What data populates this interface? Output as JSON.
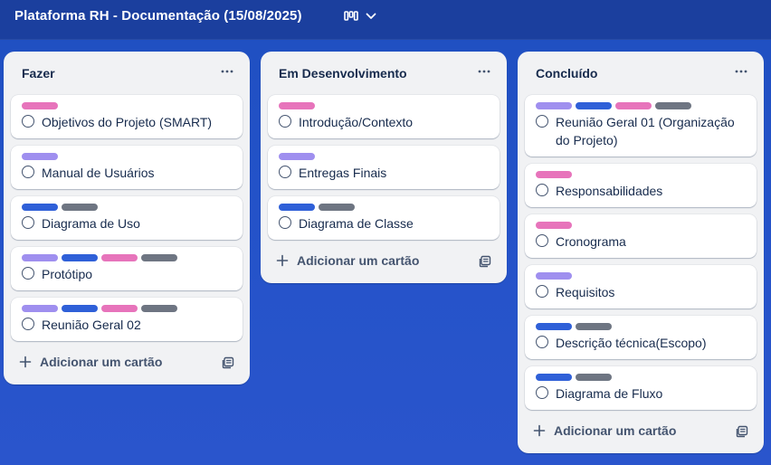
{
  "board": {
    "title": "Plataforma RH - Documentação (15/08/2025)"
  },
  "colors": {
    "purple": "#9f8fef",
    "blue": "#2f60d8",
    "pink": "#e774bb",
    "gray": "#6e7582"
  },
  "lists": [
    {
      "title": "Fazer",
      "add_label": "Adicionar um cartão",
      "cards": [
        {
          "title": "Objetivos do Projeto (SMART)",
          "labels": [
            "pink"
          ]
        },
        {
          "title": "Manual de Usuários",
          "labels": [
            "purple"
          ]
        },
        {
          "title": "Diagrama de Uso",
          "labels": [
            "blue",
            "gray"
          ]
        },
        {
          "title": "Protótipo",
          "labels": [
            "purple",
            "blue",
            "pink",
            "gray"
          ]
        },
        {
          "title": "Reunião Geral 02",
          "labels": [
            "purple",
            "blue",
            "pink",
            "gray"
          ]
        }
      ]
    },
    {
      "title": "Em Desenvolvimento",
      "add_label": "Adicionar um cartão",
      "cards": [
        {
          "title": "Introdução/Contexto",
          "labels": [
            "pink"
          ]
        },
        {
          "title": "Entregas Finais",
          "labels": [
            "purple"
          ]
        },
        {
          "title": "Diagrama de Classe",
          "labels": [
            "blue",
            "gray"
          ]
        }
      ]
    },
    {
      "title": "Concluído",
      "add_label": "Adicionar um cartão",
      "cards": [
        {
          "title": "Reunião Geral 01 (Organização do Projeto)",
          "labels": [
            "purple",
            "blue",
            "pink",
            "gray"
          ]
        },
        {
          "title": "Responsabilidades",
          "labels": [
            "pink"
          ]
        },
        {
          "title": "Cronograma",
          "labels": [
            "pink"
          ]
        },
        {
          "title": "Requisitos",
          "labels": [
            "purple"
          ]
        },
        {
          "title": "Descrição técnica(Escopo)",
          "labels": [
            "blue",
            "gray"
          ]
        },
        {
          "title": "Diagrama de Fluxo",
          "labels": [
            "blue",
            "gray"
          ]
        }
      ]
    }
  ]
}
